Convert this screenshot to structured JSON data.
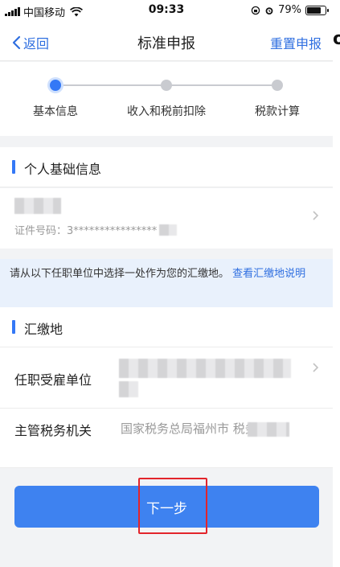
{
  "status_bar": {
    "carrier": "中国移动",
    "time": "09:33",
    "battery_pct": "79%",
    "battery_level": 0.79
  },
  "nav": {
    "back_label": "返回",
    "title": "标准申报",
    "reset_label": "重置申报"
  },
  "edge_glyph": "o",
  "steps": [
    {
      "label": "基本信息",
      "active": true
    },
    {
      "label": "收入和税前扣除",
      "active": false
    },
    {
      "label": "税款计算",
      "active": false
    }
  ],
  "personal": {
    "section_title": "个人基础信息",
    "id_label": "证件号码：3****************"
  },
  "notice": {
    "text": "请从以下任职单位中选择一处作为您的汇缴地。",
    "link": "查看汇缴地说明"
  },
  "payment_place": {
    "section_title": "汇缴地",
    "employer_label": "任职受雇单位",
    "tax_office_label": "主管税务机关",
    "tax_office_value": "国家税务总局福州市      税务局"
  },
  "next_button": "下一步",
  "colors": {
    "accent": "#3478f6",
    "button": "#3e82f0",
    "highlight": "#e3242b",
    "notice_bg": "#e9f1fc"
  }
}
